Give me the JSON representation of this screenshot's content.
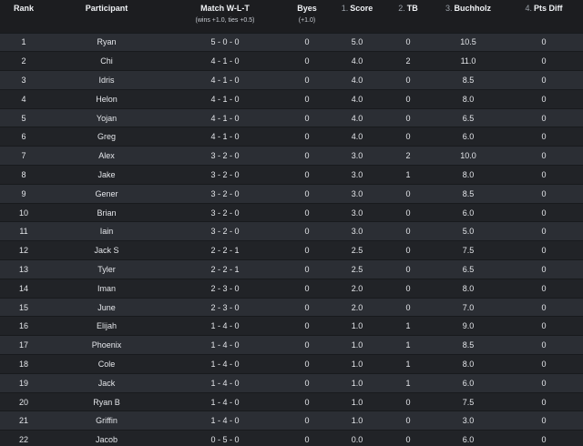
{
  "headers": {
    "rank": "Rank",
    "participant": "Participant",
    "match": "Match W-L-T",
    "match_sub": "(wins +1.0, ties +0.5)",
    "byes": "Byes",
    "byes_sub": "(+1.0)",
    "score_num": "1.",
    "score": "Score",
    "tb_num": "2.",
    "tb": "TB",
    "buchholz_num": "3.",
    "buchholz": "Buchholz",
    "pts_num": "4.",
    "pts_diff": "Pts Diff"
  },
  "rows": [
    {
      "rank": "1",
      "participant": "Ryan",
      "match": "5 - 0 - 0",
      "byes": "0",
      "score": "5.0",
      "tb": "0",
      "buchholz": "10.5",
      "pts_diff": "0"
    },
    {
      "rank": "2",
      "participant": "Chi",
      "match": "4 - 1 - 0",
      "byes": "0",
      "score": "4.0",
      "tb": "2",
      "buchholz": "11.0",
      "pts_diff": "0"
    },
    {
      "rank": "3",
      "participant": "Idris",
      "match": "4 - 1 - 0",
      "byes": "0",
      "score": "4.0",
      "tb": "0",
      "buchholz": "8.5",
      "pts_diff": "0"
    },
    {
      "rank": "4",
      "participant": "Helon",
      "match": "4 - 1 - 0",
      "byes": "0",
      "score": "4.0",
      "tb": "0",
      "buchholz": "8.0",
      "pts_diff": "0"
    },
    {
      "rank": "5",
      "participant": "Yojan",
      "match": "4 - 1 - 0",
      "byes": "0",
      "score": "4.0",
      "tb": "0",
      "buchholz": "6.5",
      "pts_diff": "0"
    },
    {
      "rank": "6",
      "participant": "Greg",
      "match": "4 - 1 - 0",
      "byes": "0",
      "score": "4.0",
      "tb": "0",
      "buchholz": "6.0",
      "pts_diff": "0"
    },
    {
      "rank": "7",
      "participant": "Alex",
      "match": "3 - 2 - 0",
      "byes": "0",
      "score": "3.0",
      "tb": "2",
      "buchholz": "10.0",
      "pts_diff": "0"
    },
    {
      "rank": "8",
      "participant": "Jake",
      "match": "3 - 2 - 0",
      "byes": "0",
      "score": "3.0",
      "tb": "1",
      "buchholz": "8.0",
      "pts_diff": "0"
    },
    {
      "rank": "9",
      "participant": "Gener",
      "match": "3 - 2 - 0",
      "byes": "0",
      "score": "3.0",
      "tb": "0",
      "buchholz": "8.5",
      "pts_diff": "0"
    },
    {
      "rank": "10",
      "participant": "Brian",
      "match": "3 - 2 - 0",
      "byes": "0",
      "score": "3.0",
      "tb": "0",
      "buchholz": "6.0",
      "pts_diff": "0"
    },
    {
      "rank": "11",
      "participant": "Iain",
      "match": "3 - 2 - 0",
      "byes": "0",
      "score": "3.0",
      "tb": "0",
      "buchholz": "5.0",
      "pts_diff": "0"
    },
    {
      "rank": "12",
      "participant": "Jack S",
      "match": "2 - 2 - 1",
      "byes": "0",
      "score": "2.5",
      "tb": "0",
      "buchholz": "7.5",
      "pts_diff": "0"
    },
    {
      "rank": "13",
      "participant": "Tyler",
      "match": "2 - 2 - 1",
      "byes": "0",
      "score": "2.5",
      "tb": "0",
      "buchholz": "6.5",
      "pts_diff": "0"
    },
    {
      "rank": "14",
      "participant": "Iman",
      "match": "2 - 3 - 0",
      "byes": "0",
      "score": "2.0",
      "tb": "0",
      "buchholz": "8.0",
      "pts_diff": "0"
    },
    {
      "rank": "15",
      "participant": "June",
      "match": "2 - 3 - 0",
      "byes": "0",
      "score": "2.0",
      "tb": "0",
      "buchholz": "7.0",
      "pts_diff": "0"
    },
    {
      "rank": "16",
      "participant": "Elijah",
      "match": "1 - 4 - 0",
      "byes": "0",
      "score": "1.0",
      "tb": "1",
      "buchholz": "9.0",
      "pts_diff": "0"
    },
    {
      "rank": "17",
      "participant": "Phoenix",
      "match": "1 - 4 - 0",
      "byes": "0",
      "score": "1.0",
      "tb": "1",
      "buchholz": "8.5",
      "pts_diff": "0"
    },
    {
      "rank": "18",
      "participant": "Cole",
      "match": "1 - 4 - 0",
      "byes": "0",
      "score": "1.0",
      "tb": "1",
      "buchholz": "8.0",
      "pts_diff": "0"
    },
    {
      "rank": "19",
      "participant": "Jack",
      "match": "1 - 4 - 0",
      "byes": "0",
      "score": "1.0",
      "tb": "1",
      "buchholz": "6.0",
      "pts_diff": "0"
    },
    {
      "rank": "20",
      "participant": "Ryan B",
      "match": "1 - 4 - 0",
      "byes": "0",
      "score": "1.0",
      "tb": "0",
      "buchholz": "7.5",
      "pts_diff": "0"
    },
    {
      "rank": "21",
      "participant": "Griffin",
      "match": "1 - 4 - 0",
      "byes": "0",
      "score": "1.0",
      "tb": "0",
      "buchholz": "3.0",
      "pts_diff": "0"
    },
    {
      "rank": "22",
      "participant": "Jacob",
      "match": "0 - 5 - 0",
      "byes": "0",
      "score": "0.0",
      "tb": "0",
      "buchholz": "6.0",
      "pts_diff": "0"
    }
  ]
}
